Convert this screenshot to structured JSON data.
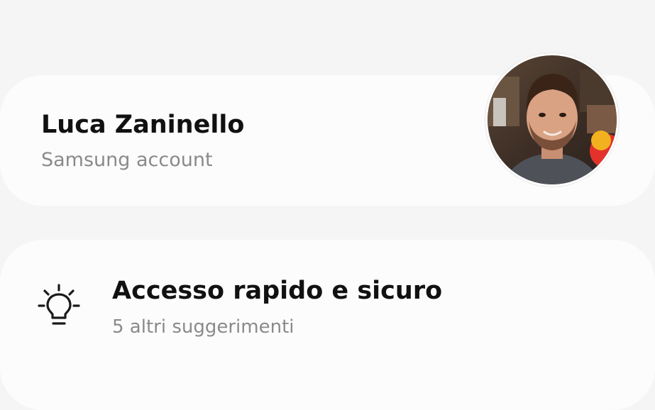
{
  "header": {
    "search_icon": "search-icon"
  },
  "account": {
    "name": "Luca Zaninello",
    "subtitle": "Samsung account",
    "avatar_icon": "profile-photo"
  },
  "suggestions": {
    "icon": "lightbulb-icon",
    "title": "Accesso rapido e sicuro",
    "subtitle": "5 altri suggerimenti"
  },
  "colors": {
    "background": "#f5f5f5",
    "card": "#fcfcfc",
    "primary_text": "#111111",
    "secondary_text": "#8a8a8a"
  }
}
